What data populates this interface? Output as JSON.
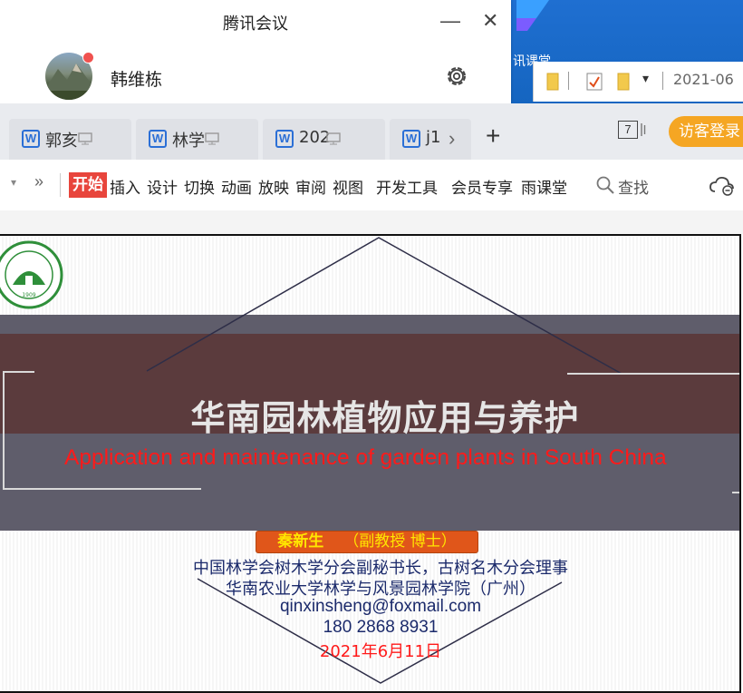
{
  "desktop": {
    "app_label": "讯课堂",
    "explorer_date": "2021-06"
  },
  "meeting": {
    "title": "腾讯会议",
    "minimize": "—",
    "close": "✕",
    "user_name": "韩维栋"
  },
  "tabs": [
    {
      "label": "郭亥"
    },
    {
      "label": "林学"
    },
    {
      "label": "202"
    },
    {
      "label": "j1"
    }
  ],
  "tabbar": {
    "add": "+",
    "scroll": "›",
    "window_count": "7",
    "visitor_login": "访客登录"
  },
  "menu": {
    "more": "»",
    "arrow": "▾",
    "start": "开始",
    "items": [
      "插入",
      "设计",
      "切换",
      "动画",
      "放映",
      "审阅",
      "视图",
      "开发工具",
      "会员专享",
      "雨课堂"
    ],
    "search": "查找"
  },
  "slide": {
    "title": "华南园林植物应用与养护",
    "subtitle": "Application and maintenance of garden plants in South China",
    "logo_year": "1909",
    "author_name": "秦新生",
    "author_title": "（副教授  博士）",
    "info_line1": "中国林学会树木学分会副秘书长，古树名木分会理事",
    "info_line2": "华南农业大学林学与风景园林学院（广州）",
    "email": "qinxinsheng@foxmail.com",
    "phone": "180 2868 8931",
    "date": "2021年6月11日"
  },
  "colors": {
    "accent_orange": "#f5a623",
    "start_red": "#e8453c",
    "title_band": "#5b3b3d",
    "outer_band": "#5f5d6b",
    "subtitle_red": "#ff1a1a",
    "info_blue": "#1b2a6b"
  }
}
